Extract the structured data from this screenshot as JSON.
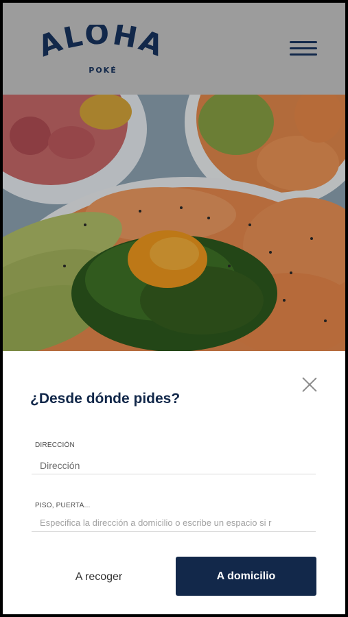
{
  "brand": {
    "name": "ALOHA",
    "sub": "POKÉ",
    "color": "#12284a"
  },
  "header": {
    "menu_icon": "hamburger-menu-icon"
  },
  "hero": {
    "image_description": "poke bowls with salmon, tuna, avocado and seaweed"
  },
  "modal": {
    "close_icon": "close-icon",
    "title": "¿Desde dónde pides?",
    "address": {
      "label": "DIRECCIÓN",
      "placeholder": "Dirección",
      "value": ""
    },
    "floor": {
      "label": "PISO, PUERTA...",
      "placeholder": "Especifica la dirección a domicilio o escribe un espacio si r",
      "value": ""
    },
    "pickup_label": "A recoger",
    "delivery_label": "A domicilio"
  },
  "colors": {
    "primary": "#12284a",
    "header_bg": "#9c9c9c"
  }
}
